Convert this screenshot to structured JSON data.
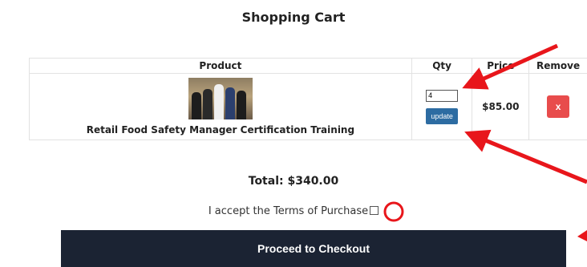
{
  "page": {
    "title": "Shopping Cart"
  },
  "cart": {
    "headers": {
      "product": "Product",
      "qty": "Qty",
      "price": "Price",
      "remove": "Remove"
    },
    "items": [
      {
        "name": "Retail Food Safety Manager Certification Training",
        "qty": "4",
        "update_label": "update",
        "price": "$85.00",
        "remove_label": "x"
      }
    ]
  },
  "total": {
    "text": "Total: $340.00"
  },
  "terms": {
    "label": "I accept the Terms of Purchase"
  },
  "checkout": {
    "label": "Proceed to Checkout"
  },
  "colors": {
    "update_button": "#2d6ca2",
    "remove_button": "#e84c4c",
    "checkout_button": "#1b2333",
    "annotation_red": "#e8161b"
  }
}
